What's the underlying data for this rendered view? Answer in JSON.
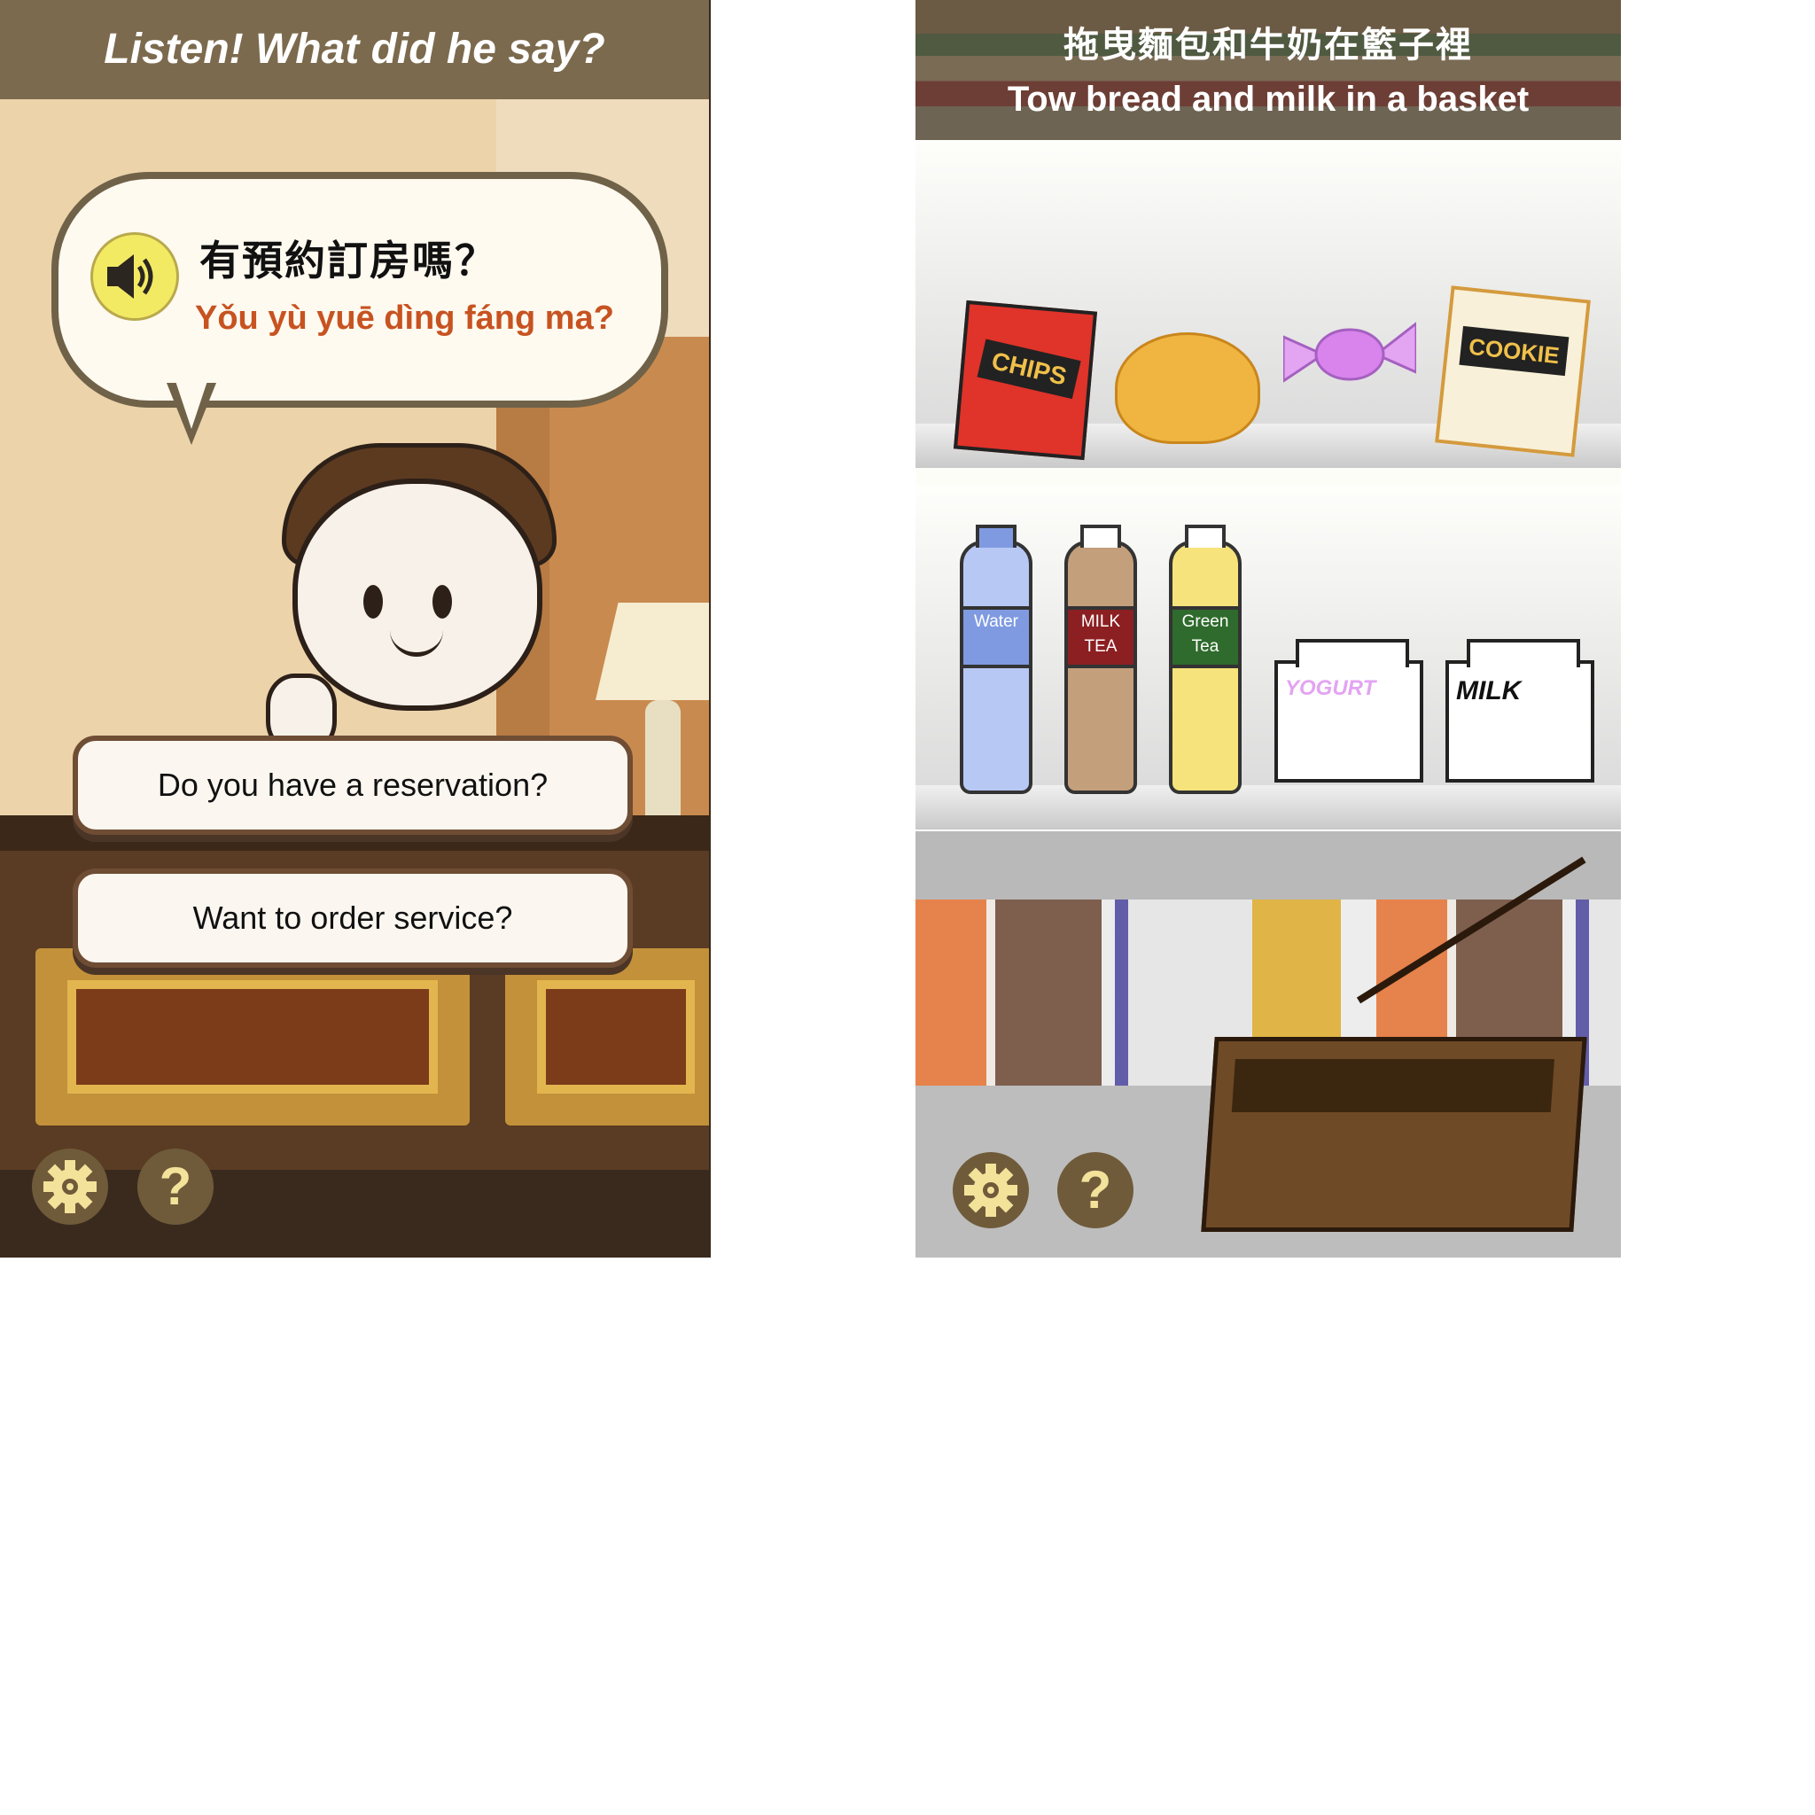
{
  "left_screen": {
    "header": {
      "title": "Listen! What did he say?"
    },
    "bubble": {
      "chinese": "有預約訂房嗎？",
      "pinyin": "Yǒu yù yuē dìng fáng ma?",
      "speaker_icon": "speaker-icon"
    },
    "answers": [
      {
        "label": "Do you have a reservation?"
      },
      {
        "label": "Want to order service?"
      }
    ],
    "controls": {
      "settings_icon": "gear-icon",
      "help_label": "?"
    }
  },
  "right_screen": {
    "header": {
      "chinese": "拖曳麵包和牛奶在籃子裡",
      "english": "Tow bread and milk in a basket"
    },
    "top_shelf": {
      "items": [
        {
          "name": "chips",
          "label": "CHIPS"
        },
        {
          "name": "bread",
          "label": ""
        },
        {
          "name": "candy",
          "label": ""
        },
        {
          "name": "cookie",
          "label": "COOKIE"
        }
      ]
    },
    "middle_shelf": {
      "items": [
        {
          "name": "water",
          "label": "Water",
          "color": "#b8c8f4"
        },
        {
          "name": "milk-tea",
          "label": "MILK TEA",
          "color": "#c49f7c"
        },
        {
          "name": "green-tea",
          "label": "Green Tea",
          "color": "#f7e37c"
        },
        {
          "name": "yogurt",
          "label": "YOGURT"
        },
        {
          "name": "milk",
          "label": "MILK"
        }
      ]
    },
    "controls": {
      "settings_icon": "gear-icon",
      "help_label": "?"
    }
  },
  "colors": {
    "header_brown": "#7c6a4e",
    "pinyin_orange": "#c75321",
    "button_brown": "#6f5b3a",
    "icon_yellow": "#f3e29a",
    "speaker_yellow": "#f3ea63"
  }
}
